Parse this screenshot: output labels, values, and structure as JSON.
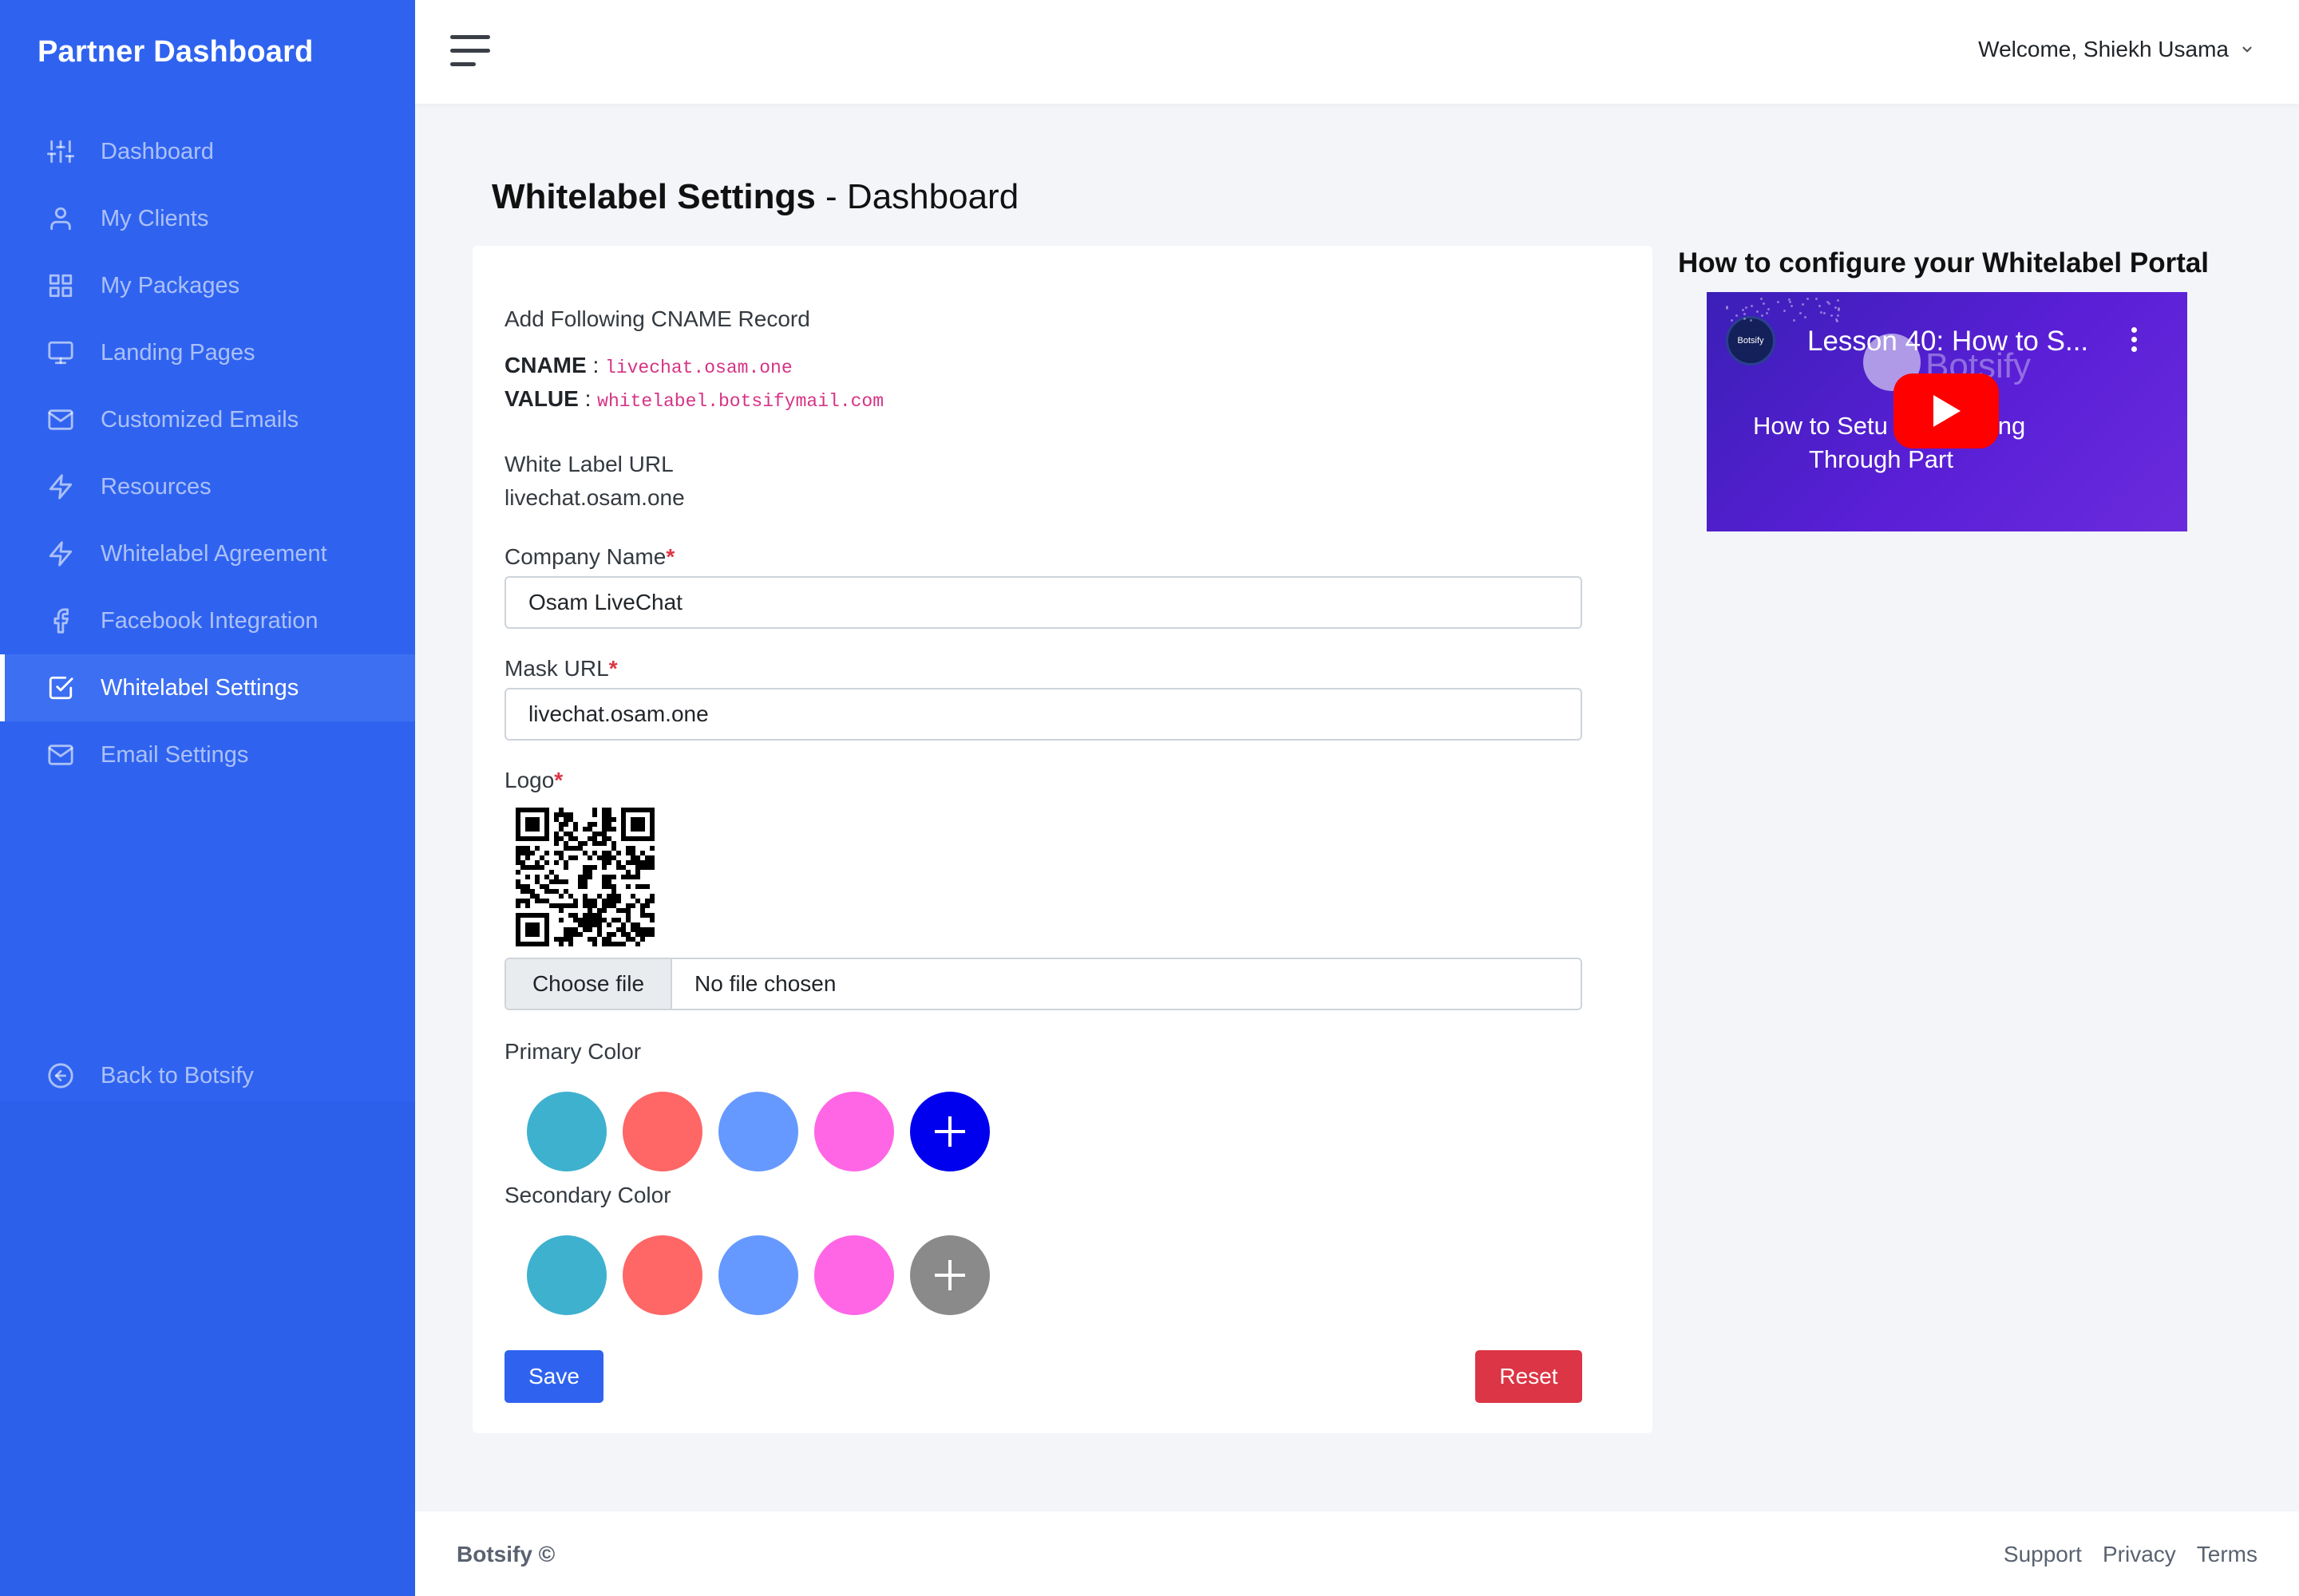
{
  "sidebar": {
    "brand": "Partner Dashboard",
    "items": [
      {
        "label": "Dashboard",
        "icon": "sliders-icon"
      },
      {
        "label": "My Clients",
        "icon": "user-icon"
      },
      {
        "label": "My Packages",
        "icon": "grid-icon"
      },
      {
        "label": "Landing Pages",
        "icon": "monitor-icon"
      },
      {
        "label": "Customized Emails",
        "icon": "mail-icon"
      },
      {
        "label": "Resources",
        "icon": "bolt-icon"
      },
      {
        "label": "Whitelabel Agreement",
        "icon": "bolt-icon"
      },
      {
        "label": "Facebook Integration",
        "icon": "facebook-icon"
      },
      {
        "label": "Whitelabel Settings",
        "icon": "check-square-icon",
        "active": true
      },
      {
        "label": "Email Settings",
        "icon": "mail-icon"
      }
    ],
    "back": {
      "label": "Back to Botsify",
      "icon": "arrow-left-circle-icon"
    }
  },
  "header": {
    "welcome": "Welcome, Shiekh Usama"
  },
  "page": {
    "title_bold": "Whitelabel Settings",
    "title_rest": " - Dashboard"
  },
  "form": {
    "cname_heading": "Add Following CNAME Record",
    "cname_label": "CNAME",
    "cname_value": "livechat.osam.one",
    "value_label": "VALUE",
    "value_value": "whitelabel.botsifymail.com",
    "wl_url_label": "White Label URL",
    "wl_url_value": "livechat.osam.one",
    "company_label": "Company Name",
    "company_value": "Osam LiveChat",
    "mask_label": "Mask URL",
    "mask_value": "livechat.osam.one",
    "logo_label": "Logo",
    "file_button": "Choose file",
    "file_status": "No file chosen",
    "primary_label": "Primary Color",
    "secondary_label": "Secondary Color",
    "primary_colors": [
      "#3eb1cf",
      "#ff6666",
      "#6699ff",
      "#ff66e6"
    ],
    "primary_custom": "#0000ee",
    "secondary_colors": [
      "#3eb1cf",
      "#ff6666",
      "#6699ff",
      "#ff66e6"
    ],
    "secondary_custom": "#8a8a8a",
    "save": "Save",
    "reset": "Reset",
    "required_mark": "*"
  },
  "video": {
    "heading": "How to configure your Whitelabel Portal",
    "title": "Lesson 40: How to S...",
    "channel": "Botsify",
    "watermark": "Botsify",
    "subtitle_1": "How to Setu         abel Setting",
    "subtitle_2": "Through Part"
  },
  "footer": {
    "copyright": "Botsify ©",
    "links": [
      "Support",
      "Privacy",
      "Terms"
    ]
  }
}
